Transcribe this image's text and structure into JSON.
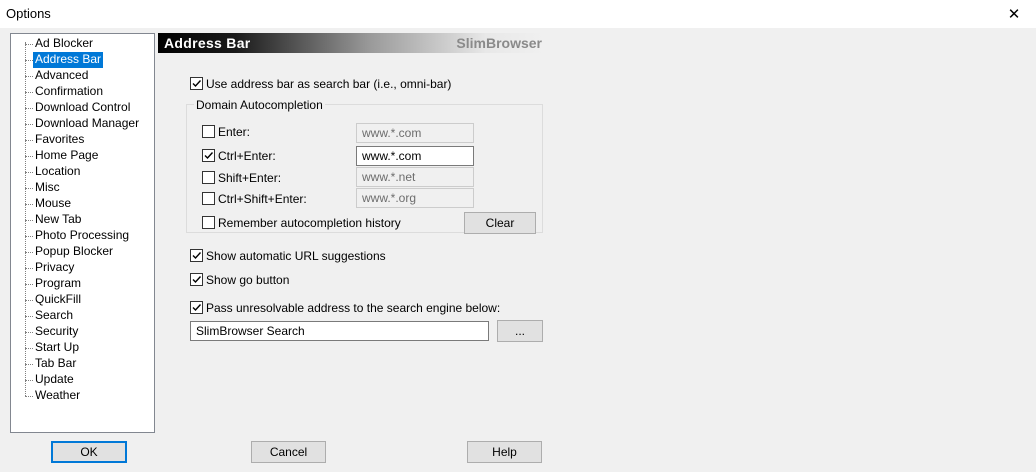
{
  "window": {
    "title": "Options",
    "close_glyph": "✕"
  },
  "tree": {
    "items": [
      "Ad Blocker",
      "Address Bar",
      "Advanced",
      "Confirmation",
      "Download Control",
      "Download Manager",
      "Favorites",
      "Home Page",
      "Location",
      "Misc",
      "Mouse",
      "New Tab",
      "Photo Processing",
      "Popup Blocker",
      "Privacy",
      "Program",
      "QuickFill",
      "Search",
      "Security",
      "Start Up",
      "Tab Bar",
      "Update",
      "Weather"
    ],
    "selected": "Address Bar"
  },
  "header": {
    "title": "Address Bar",
    "brand": "SlimBrowser"
  },
  "options": {
    "omnibar": {
      "label": "Use address bar as search bar (i.e., omni-bar)",
      "checked": true
    },
    "group_title": "Domain Autocompletion",
    "autocompletion": [
      {
        "label": "Enter:",
        "checked": false,
        "value": "www.*.com"
      },
      {
        "label": "Ctrl+Enter:",
        "checked": true,
        "value": "www.*.com"
      },
      {
        "label": "Shift+Enter:",
        "checked": false,
        "value": "www.*.net"
      },
      {
        "label": "Ctrl+Shift+Enter:",
        "checked": false,
        "value": "www.*.org"
      }
    ],
    "remember": {
      "label": "Remember autocompletion history",
      "checked": false
    },
    "clear_label": "Clear",
    "url_suggestions": {
      "label": "Show automatic URL suggestions",
      "checked": true
    },
    "go_button": {
      "label": "Show go button",
      "checked": true
    },
    "pass_unresolvable": {
      "label": "Pass unresolvable address to the search engine below:",
      "checked": true
    },
    "search_engine": "SlimBrowser Search",
    "browse_label": "..."
  },
  "buttons": {
    "ok": "OK",
    "cancel": "Cancel",
    "help": "Help"
  },
  "colors": {
    "selection": "#0078d7",
    "default_button_border": "#0078d7"
  }
}
